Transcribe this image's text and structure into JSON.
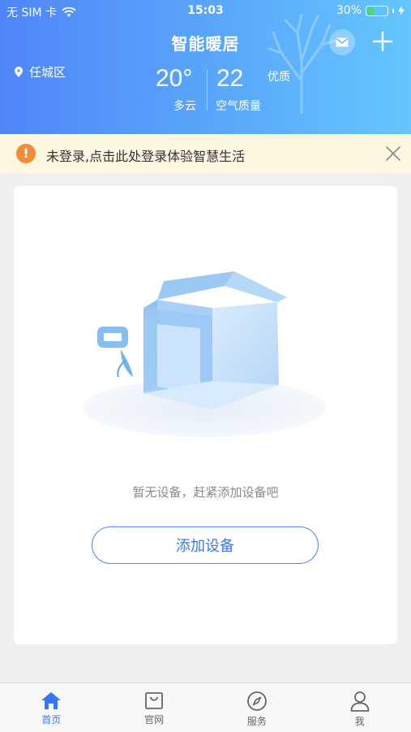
{
  "status_bar": {
    "carrier": "无 SIM 卡",
    "time": "15:03",
    "battery_percent": "30%",
    "battery_level": 0.3
  },
  "header": {
    "title": "智能暖居",
    "location": "任城区",
    "temperature": "20°",
    "weather": "多云",
    "aqi_value": "22",
    "aqi_level": "优质",
    "aqi_label": "空气质量"
  },
  "banner": {
    "text": "未登录,点击此处登录体验智慧生活",
    "icon": "!"
  },
  "empty_state": {
    "message": "暂无设备，赶紧添加设备吧",
    "add_button": "添加设备"
  },
  "tabbar": {
    "items": [
      {
        "label": "首页",
        "icon": "home-icon",
        "active": true
      },
      {
        "label": "官网",
        "icon": "bag-icon",
        "active": false
      },
      {
        "label": "服务",
        "icon": "compass-icon",
        "active": false
      },
      {
        "label": "我",
        "icon": "person-icon",
        "active": false
      }
    ]
  },
  "colors": {
    "accent": "#3478f6",
    "header_start": "#4f86f7",
    "header_end": "#64c6fd",
    "warning": "#ef8d3a",
    "banner_bg": "#fdf6e0"
  }
}
